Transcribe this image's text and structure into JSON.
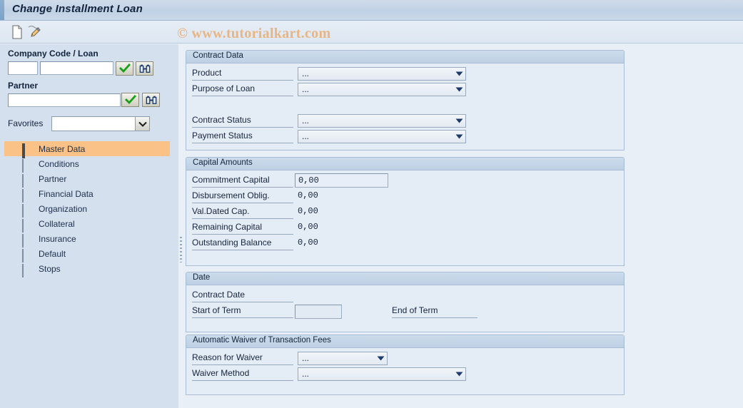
{
  "window": {
    "title": "Change Installment Loan",
    "watermark": "© www.tutorialkart.com"
  },
  "toolbar": {
    "items": [
      {
        "name": "new-document-icon",
        "label": "New Document"
      },
      {
        "name": "edit-pencil-icon",
        "label": "Edit"
      }
    ]
  },
  "sidebar": {
    "company_code_loan": {
      "heading": "Company Code / Loan",
      "code_value": "",
      "loan_value": "",
      "confirm_icon": "green-check-icon",
      "search_icon": "binoculars-icon"
    },
    "partner": {
      "heading": "Partner",
      "value": "",
      "confirm_icon": "green-check-icon",
      "search_icon": "binoculars-icon"
    },
    "favorites": {
      "label": "Favorites",
      "value": "",
      "dropdown_icon": "chevron-down-icon"
    },
    "nav_items": [
      {
        "label": "Master Data",
        "icon": "green-square-icon",
        "selected": true
      },
      {
        "label": "Conditions",
        "icon": "diamond-icon",
        "selected": false
      },
      {
        "label": "Partner",
        "icon": "diamond-icon",
        "selected": false
      },
      {
        "label": "Financial Data",
        "icon": "diamond-icon",
        "selected": false
      },
      {
        "label": "Organization",
        "icon": "diamond-icon",
        "selected": false
      },
      {
        "label": "Collateral",
        "icon": "diamond-icon",
        "selected": false
      },
      {
        "label": "Insurance",
        "icon": "diamond-icon",
        "selected": false
      },
      {
        "label": "Default",
        "icon": "diamond-icon",
        "selected": false
      },
      {
        "label": "Stops",
        "icon": "diamond-icon",
        "selected": false
      }
    ]
  },
  "main": {
    "contract_data": {
      "title": "Contract Data",
      "fields": [
        {
          "label": "Product",
          "value": "..."
        },
        {
          "label": "Purpose of Loan",
          "value": "..."
        },
        {
          "label": "Contract Status",
          "value": "..."
        },
        {
          "label": "Payment Status",
          "value": "..."
        }
      ]
    },
    "capital_amounts": {
      "title": "Capital Amounts",
      "fields": [
        {
          "label": "Commitment Capital",
          "value": "0,00",
          "editable": true
        },
        {
          "label": "Disbursement Oblig.",
          "value": "0,00",
          "editable": false
        },
        {
          "label": "Val.Dated Cap.",
          "value": "0,00",
          "editable": false
        },
        {
          "label": "Remaining Capital",
          "value": "0,00",
          "editable": false
        },
        {
          "label": "Outstanding Balance",
          "value": "0,00",
          "editable": false
        }
      ]
    },
    "date": {
      "title": "Date",
      "contract_date_label": "Contract Date",
      "start_of_term_label": "Start of Term",
      "start_of_term_value": "",
      "end_of_term_label": "End of Term"
    },
    "waiver": {
      "title": "Automatic Waiver of Transaction Fees",
      "fields": [
        {
          "label": "Reason for Waiver",
          "value": "..."
        },
        {
          "label": "Waiver Method",
          "value": "..."
        }
      ]
    }
  }
}
